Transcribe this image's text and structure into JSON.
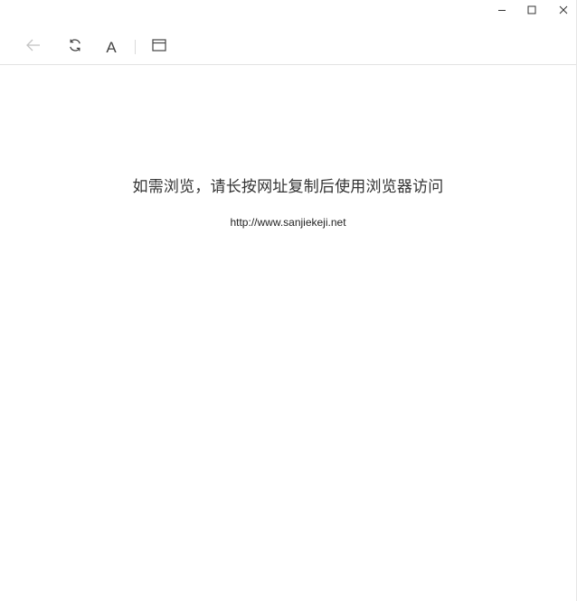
{
  "window_controls": {
    "minimize_icon": "minimize-icon",
    "maximize_icon": "maximize-icon",
    "close_icon": "close-icon"
  },
  "toolbar": {
    "back_icon": "arrow-left-icon",
    "refresh_icon": "refresh-icon",
    "font_label": "A",
    "window_icon": "browser-window-icon"
  },
  "content": {
    "message": "如需浏览，请长按网址复制后使用浏览器访问",
    "url": "http://www.sanjiekeji.net"
  },
  "colors": {
    "background": "#ffffff",
    "text": "#333333",
    "icon": "#444444",
    "icon_disabled": "#bdbdbd",
    "divider": "#e3e3e3"
  }
}
